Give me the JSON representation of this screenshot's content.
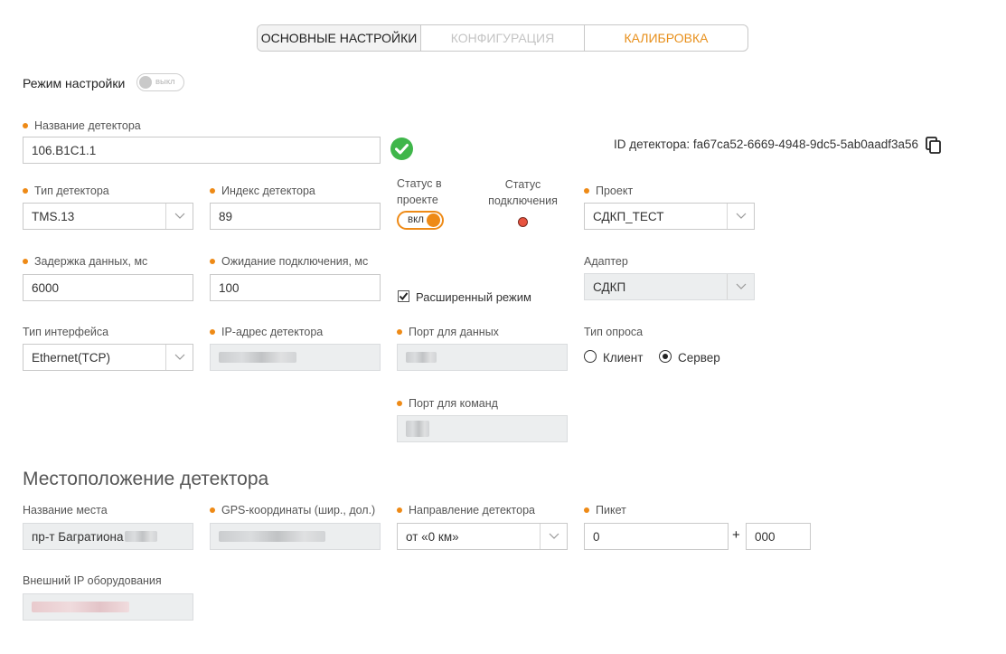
{
  "tabs": [
    {
      "label": "ОСНОВНЫЕ НАСТРОЙКИ",
      "state": "active"
    },
    {
      "label": "КОНФИГУРАЦИЯ",
      "state": "disabled"
    },
    {
      "label": "КАЛИБРОВКА",
      "state": "accent"
    }
  ],
  "setup_mode": {
    "label": "Режим настройки",
    "toggle_text": "выкл",
    "enabled": false
  },
  "detector_name": {
    "label": "Название детектора",
    "value": "106.B1C1.1",
    "valid_icon": "check-circle-icon"
  },
  "detector_id": {
    "text": "ID детектора: fa67ca52-6669-4948-9dc5-5ab0aadf3a56",
    "copy_icon": "copy-icon"
  },
  "detector_type": {
    "label": "Тип детектора",
    "value": "TMS.13"
  },
  "detector_index": {
    "label": "Индекс детектора",
    "value": "89"
  },
  "project_status": {
    "label_line1": "Статус в",
    "label_line2": "проекте",
    "toggle_text": "вкл",
    "enabled": true
  },
  "connection_status": {
    "label_line1": "Статус",
    "label_line2": "подключения",
    "color": "#e8533f"
  },
  "project": {
    "label": "Проект",
    "value": "СДКП_ТЕСТ"
  },
  "data_delay": {
    "label": "Задержка данных, мс",
    "value": "6000"
  },
  "connect_wait": {
    "label": "Ожидание подключения, мс",
    "value": "100"
  },
  "extended_mode": {
    "label": "Расширенный режим",
    "checked": true
  },
  "adapter": {
    "label": "Адаптер",
    "value": "СДКП"
  },
  "interface_type": {
    "label": "Тип интерфейса",
    "value": "Ethernet(TCP)"
  },
  "ip_address": {
    "label": "IP-адрес детектора"
  },
  "data_port": {
    "label": "Порт для данных"
  },
  "command_port": {
    "label": "Порт для команд"
  },
  "poll_type": {
    "label": "Тип опроса",
    "options": [
      "Клиент",
      "Сервер"
    ],
    "selected": "Сервер"
  },
  "location": {
    "title": "Местоположение детектора",
    "place_name": {
      "label": "Название места",
      "value": "пр-т Багратиона"
    },
    "gps": {
      "label": "GPS-координаты (шир., дол.)"
    },
    "direction": {
      "label": "Направление детектора",
      "value": "от «0 км»"
    },
    "picket": {
      "label": "Пикет",
      "value_km": "0",
      "plus": "+",
      "value_m": "000"
    },
    "external_ip": {
      "label": "Внешний IP оборудования"
    }
  },
  "colors": {
    "accent": "#ee8a16",
    "valid": "#3fb64a",
    "status_red": "#e8533f"
  }
}
